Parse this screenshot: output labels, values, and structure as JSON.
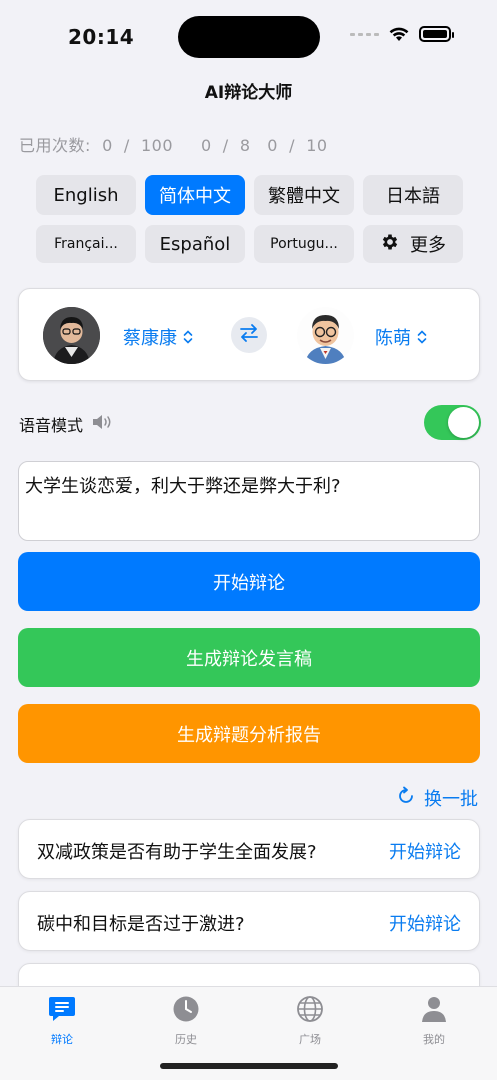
{
  "status_bar": {
    "time": "20:14"
  },
  "nav": {
    "title": "AI辩论大师"
  },
  "usage": {
    "text": "已用次数:  0  /  100     0  /  8   0  /  10"
  },
  "languages": [
    {
      "label": "English",
      "active": false
    },
    {
      "label": "简体中文",
      "active": true
    },
    {
      "label": "繁體中文",
      "active": false
    },
    {
      "label": "日本語",
      "active": false
    },
    {
      "label": "Françai...",
      "active": false
    },
    {
      "label": "Español",
      "active": false
    },
    {
      "label": "Portugu...",
      "active": false
    }
  ],
  "more_button": {
    "label": "更多",
    "icon": "gear-icon"
  },
  "debaters": {
    "left": {
      "name": "蔡康康"
    },
    "right": {
      "name": "陈萌"
    },
    "swap_icon": "swap-arrows-icon"
  },
  "voice_mode": {
    "label": "语音模式",
    "enabled": true,
    "icon": "speaker-icon"
  },
  "topic_input": {
    "value": "大学生谈恋爱，利大于弊还是弊大于利?"
  },
  "actions": {
    "start": "开始辩论",
    "speech": "生成辩论发言稿",
    "report": "生成辩题分析报告"
  },
  "refresh": {
    "label": "换一批",
    "icon": "refresh-icon"
  },
  "topics": [
    {
      "text": "双减政策是否有助于学生全面发展?",
      "action": "开始辩论"
    },
    {
      "text": "碳中和目标是否过于激进?",
      "action": "开始辩论"
    }
  ],
  "tabs": [
    {
      "label": "辩论",
      "icon": "chat-icon",
      "active": true
    },
    {
      "label": "历史",
      "icon": "clock-icon",
      "active": false
    },
    {
      "label": "广场",
      "icon": "globe-icon",
      "active": false
    },
    {
      "label": "我的",
      "icon": "person-icon",
      "active": false
    }
  ],
  "colors": {
    "accent": "#007aff",
    "green": "#34c759",
    "orange": "#ff9500",
    "link": "#0a7cf0",
    "background": "#f2f2f7"
  }
}
